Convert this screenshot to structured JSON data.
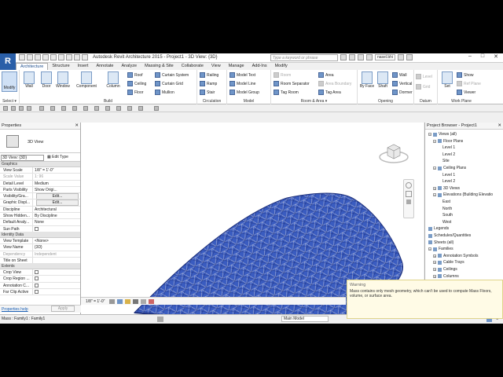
{
  "app": {
    "title": "Autodesk Revit Architecture 2015 -    Project1 - 3D View: {3D}",
    "logo": "R",
    "search_placeholder": "Type a keyword or phrase",
    "username": "nasel.bhi",
    "win_min": "–",
    "win_max": "□",
    "win_close": "✕"
  },
  "tabs": [
    "Architecture",
    "Structure",
    "Insert",
    "Annotate",
    "Analyze",
    "Massing & Site",
    "Collaborate",
    "View",
    "Manage",
    "Add-Ins",
    "Modify"
  ],
  "ribbon": {
    "select": {
      "modify": "Modify",
      "label": "Select ▾"
    },
    "build": {
      "label": "Build",
      "big": [
        "Wall",
        "Door",
        "Window",
        "Component",
        "Column"
      ],
      "small": [
        "Roof",
        "Ceiling",
        "Floor",
        "Curtain System",
        "Curtain Grid",
        "Mullion"
      ]
    },
    "circulation": {
      "label": "Circulation",
      "items": [
        "Railing",
        "Ramp",
        "Stair"
      ]
    },
    "model": {
      "label": "Model",
      "items": [
        "Model Text",
        "Model Line",
        "Model Group"
      ]
    },
    "room": {
      "label": "Room & Area ▾",
      "items": [
        "Room",
        "Room Separator",
        "Tag Room",
        "Area",
        "Area Boundary",
        "Tag Area"
      ]
    },
    "opening": {
      "label": "Opening",
      "items": [
        "By Face",
        "Shaft",
        "Wall",
        "Vertical",
        "Dormer"
      ]
    },
    "datum": {
      "label": "Datum",
      "items": [
        "Level",
        "Grid"
      ]
    },
    "workplane": {
      "label": "Work Plane",
      "items": [
        "Set",
        "Show",
        "Ref Plane",
        "Viewer"
      ]
    }
  },
  "properties": {
    "title": "Properties",
    "close": "✕",
    "type_name": "3D View",
    "view_selector": "3D View: {3D}",
    "edit_type": "Edit Type",
    "sections": {
      "graphics": "Graphics",
      "identity": "Identity Data",
      "extents": "Extents"
    },
    "graphics_rows": [
      {
        "k": "View Scale",
        "v": "1/8\" = 1'-0\""
      },
      {
        "k": "Scale Value",
        "v": "1: 96"
      },
      {
        "k": "Detail Level",
        "v": "Medium"
      },
      {
        "k": "Parts Visibility",
        "v": "Show Origi..."
      },
      {
        "k": "Visibility/Gra...",
        "v": "Edit..."
      },
      {
        "k": "Graphic Displ...",
        "v": "Edit..."
      },
      {
        "k": "Discipline",
        "v": "Architectural"
      },
      {
        "k": "Show Hidden...",
        "v": "By Discipline"
      },
      {
        "k": "Default Analy...",
        "v": "None"
      },
      {
        "k": "Sun Path",
        "v": ""
      }
    ],
    "identity_rows": [
      {
        "k": "View Template",
        "v": "<None>"
      },
      {
        "k": "View Name",
        "v": "{3D}"
      },
      {
        "k": "Dependency",
        "v": "Independent"
      },
      {
        "k": "Title on Sheet",
        "v": ""
      }
    ],
    "extents_rows": [
      {
        "k": "Crop View",
        "v": ""
      },
      {
        "k": "Crop Region ...",
        "v": ""
      },
      {
        "k": "Annotation C...",
        "v": ""
      },
      {
        "k": "Far Clip Active",
        "v": ""
      }
    ],
    "help": "Properties help",
    "apply": "Apply"
  },
  "browser": {
    "title": "Project Browser - Project1",
    "close": "✕",
    "items": [
      {
        "text": "Views (all)",
        "indent": 0,
        "toggle": "−"
      },
      {
        "text": "Floor Plans",
        "indent": 1,
        "toggle": "−"
      },
      {
        "text": "Level 1",
        "indent": 3,
        "toggle": ""
      },
      {
        "text": "Level 2",
        "indent": 3,
        "toggle": ""
      },
      {
        "text": "Site",
        "indent": 3,
        "toggle": ""
      },
      {
        "text": "Ceiling Plans",
        "indent": 1,
        "toggle": "−"
      },
      {
        "text": "Level 1",
        "indent": 3,
        "toggle": ""
      },
      {
        "text": "Level 2",
        "indent": 3,
        "toggle": ""
      },
      {
        "text": "3D Views",
        "indent": 1,
        "toggle": "+"
      },
      {
        "text": "Elevations (Building Elevatio",
        "indent": 1,
        "toggle": "−"
      },
      {
        "text": "East",
        "indent": 3,
        "toggle": ""
      },
      {
        "text": "North",
        "indent": 3,
        "toggle": ""
      },
      {
        "text": "South",
        "indent": 3,
        "toggle": ""
      },
      {
        "text": "West",
        "indent": 3,
        "toggle": ""
      },
      {
        "text": "Legends",
        "indent": 0,
        "toggle": ""
      },
      {
        "text": "Schedules/Quantities",
        "indent": 0,
        "toggle": ""
      },
      {
        "text": "Sheets (all)",
        "indent": 0,
        "toggle": ""
      },
      {
        "text": "Families",
        "indent": 0,
        "toggle": "−"
      },
      {
        "text": "Annotation Symbols",
        "indent": 1,
        "toggle": "+"
      },
      {
        "text": "Cable Trays",
        "indent": 1,
        "toggle": "+"
      },
      {
        "text": "Ceilings",
        "indent": 1,
        "toggle": "+"
      },
      {
        "text": "Columns",
        "indent": 1,
        "toggle": "+"
      }
    ]
  },
  "warning": {
    "title": "Warning",
    "message": "Mass contains only mesh geometry, which can't be used to compute Mass Floors, volume, or surface area."
  },
  "viewcontrol": {
    "scale": "1/8\" = 1'-0\"",
    "model": "Main Model"
  },
  "status": {
    "text": "Mass : Family1 : Family1",
    "filter": "0"
  },
  "colors": {
    "mesh": "#3656b4",
    "mesh_line": "#1d2f7a",
    "accent": "#1d4d8c"
  }
}
